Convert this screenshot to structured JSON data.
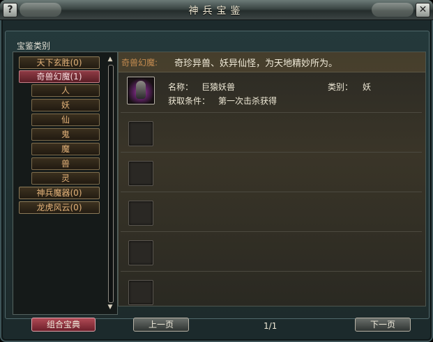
{
  "window": {
    "title": "神兵宝鉴",
    "help_label": "?",
    "close_label": "✕"
  },
  "categories_heading": "宝鉴类别",
  "categories": [
    {
      "label": "天下玄胜(0)",
      "selected": false
    },
    {
      "label": "奇兽幻魔(1)",
      "selected": true
    },
    {
      "label": "神兵魔器(0)",
      "selected": false
    },
    {
      "label": "龙虎风云(0)",
      "selected": false
    }
  ],
  "subcategories": [
    "人",
    "妖",
    "仙",
    "鬼",
    "魔",
    "兽",
    "灵"
  ],
  "scrollbar": {
    "up": "▲",
    "down": "▼"
  },
  "detail": {
    "header_title": "奇兽幻魔:",
    "header_desc": "奇珍异兽、妖异仙怪，为天地精妙所为。",
    "entry": {
      "name_label": "名称：",
      "name_value": "巨猿妖兽",
      "type_label": "类别：",
      "type_value": "妖",
      "obtain_label": "获取条件：",
      "obtain_value": "第一次击杀获得"
    }
  },
  "footer": {
    "combine_button": "组合宝典",
    "prev_button": "上一页",
    "next_button": "下一页",
    "page_info": "1/1"
  }
}
